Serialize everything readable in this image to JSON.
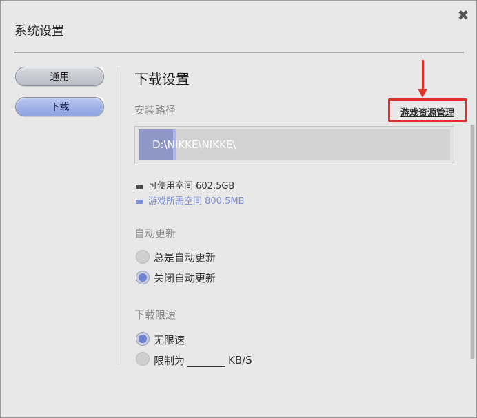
{
  "window": {
    "title": "系统设置",
    "close_glyph": "✖"
  },
  "nav": {
    "items": [
      {
        "label": "通用",
        "selected": false
      },
      {
        "label": "下载",
        "selected": true
      }
    ]
  },
  "content": {
    "section_title": "下载设置",
    "install_path": {
      "label": "安装路径",
      "manage_link": "游戏资源管理",
      "value": "D:\\NIKKE\\NIKKE\\",
      "fill_fraction": 0.12
    },
    "disk": {
      "available": {
        "label": "可使用空间 602.5GB",
        "color": "#4a4a4a"
      },
      "required": {
        "label": "游戏所需空间 800.5MB",
        "color": "#7f8fd6"
      }
    },
    "auto_update": {
      "label": "自动更新",
      "options": [
        {
          "label": "总是自动更新",
          "checked": false
        },
        {
          "label": "关闭自动更新",
          "checked": true
        }
      ]
    },
    "speed_limit": {
      "label": "下载限速",
      "options": [
        {
          "label": "无限速",
          "checked": true
        },
        {
          "label": "限制为",
          "checked": false
        }
      ],
      "limit_value": "",
      "unit": "KB/S"
    }
  },
  "colors": {
    "accent": "#7f8fd6",
    "highlight_red": "#e0302a"
  },
  "icons": {
    "close": "close-icon",
    "arrow": "arrow-down-icon"
  }
}
